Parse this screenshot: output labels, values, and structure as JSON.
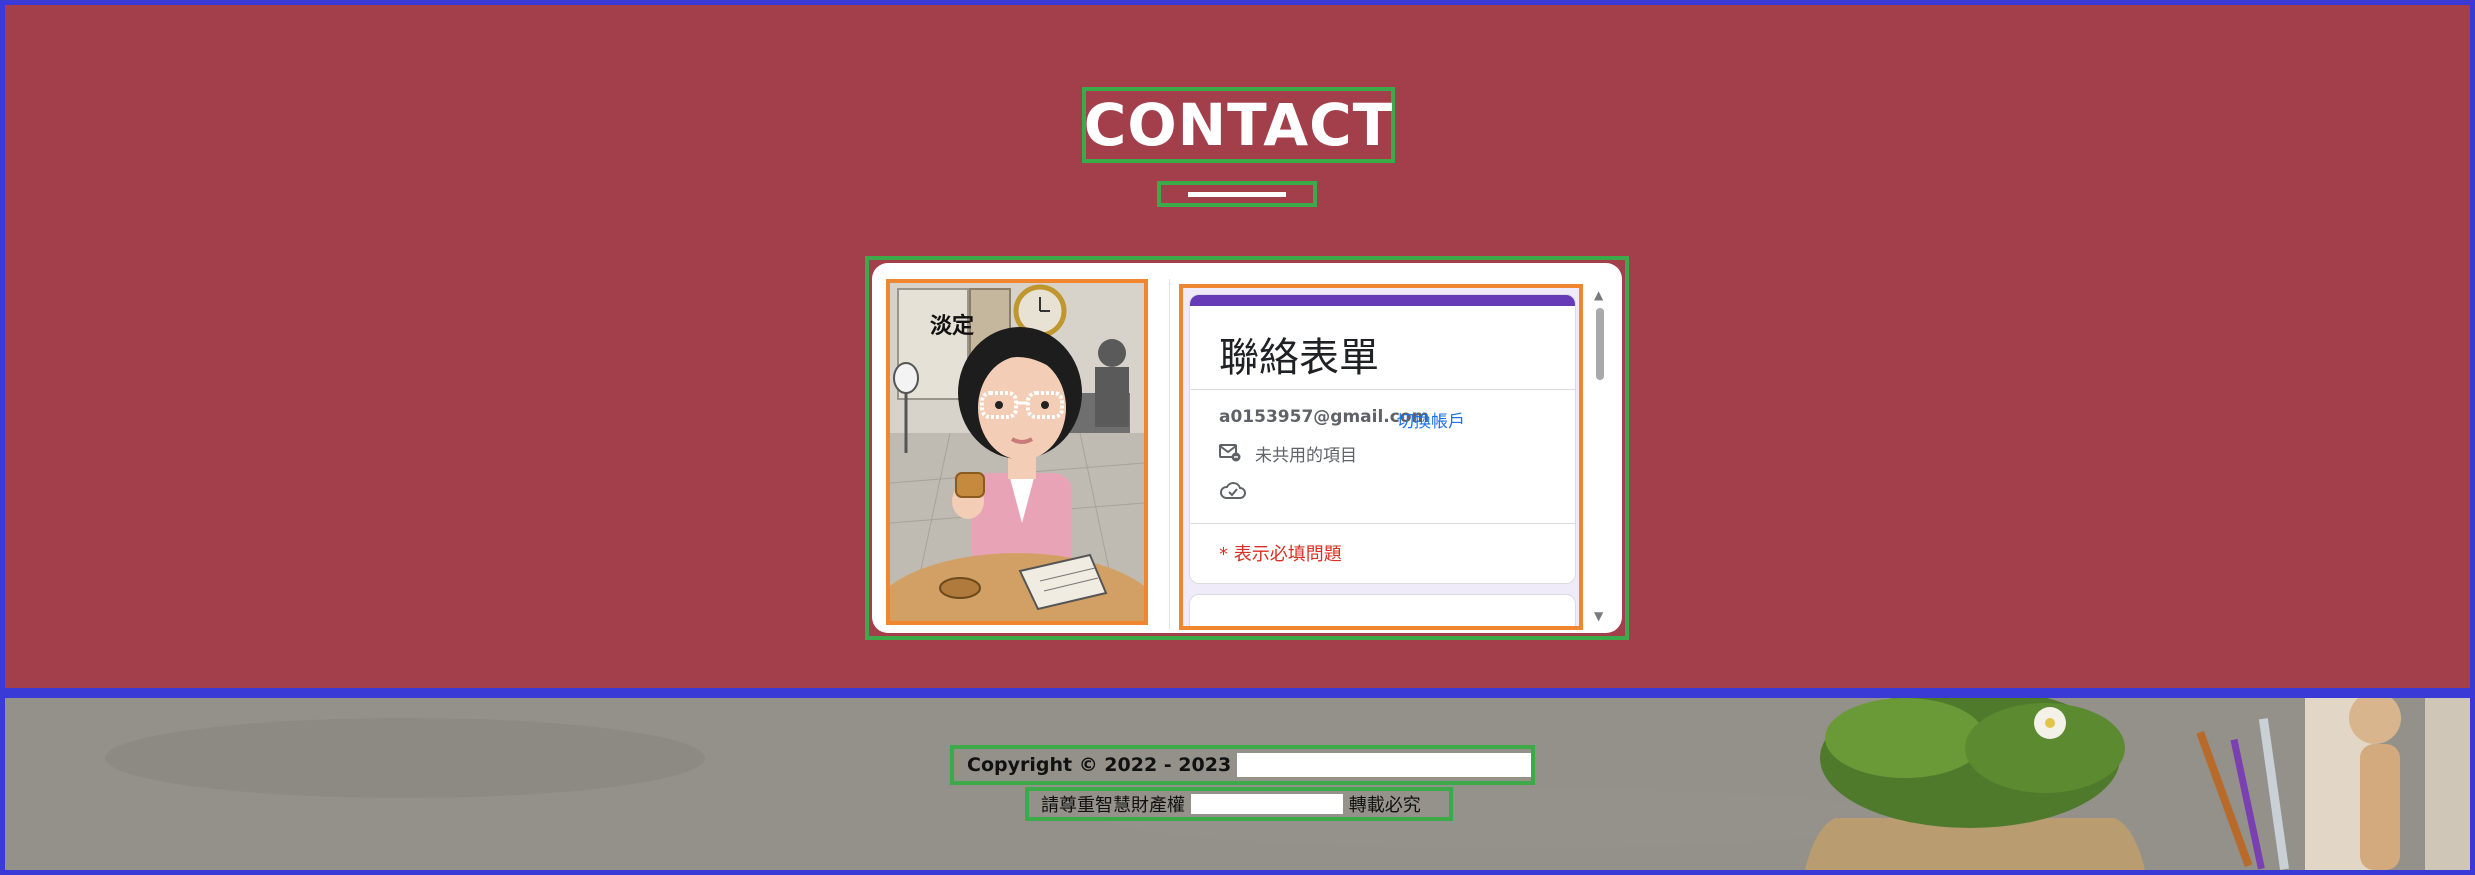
{
  "contact": {
    "title": "CONTACT",
    "colors": {
      "background": "#a33f4b",
      "title": "#ffffff"
    }
  },
  "form": {
    "title": "聯絡表單",
    "account_email": "a0153957@gmail.com",
    "switch_account_label": "切換帳戶",
    "not_shared_label": "未共用的項目",
    "required_note": "* 表示必填問題",
    "accent_color": "#673ab7",
    "avatar_sign_text": "淡定",
    "icons": [
      "mail-share-icon",
      "cloud-save-icon"
    ]
  },
  "footer": {
    "copyright_label": "Copyright © 2022 - 2023",
    "notice_prefix": "請尊重智慧財產權",
    "notice_suffix": "轉載必究"
  }
}
